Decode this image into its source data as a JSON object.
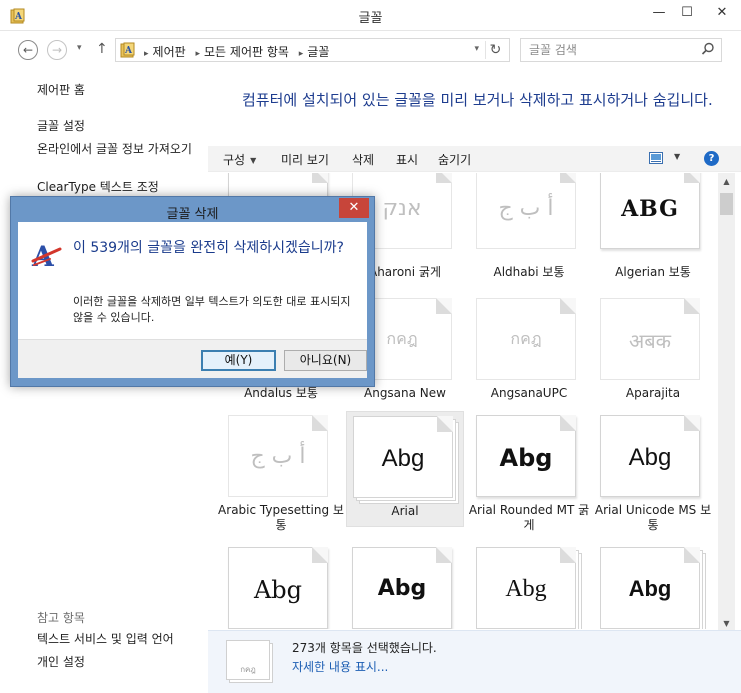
{
  "window": {
    "title": "글꼴",
    "min_glyph": "—",
    "max_glyph": "☐",
    "close_glyph": "✕"
  },
  "nav": {
    "back_glyph": "←",
    "forward_glyph": "→",
    "up_glyph": "↑",
    "recent_glyph": "▾"
  },
  "address": {
    "crumbs": [
      "제어판",
      "모든 제어판 항목",
      "글꼴"
    ],
    "separator": "▸",
    "refresh_glyph": "↻"
  },
  "search": {
    "placeholder": "글꼴 검색"
  },
  "sidebar": {
    "links": [
      {
        "label": "제어판 홈"
      },
      {
        "label": "글꼴 설정"
      },
      {
        "label": "온라인에서 글꼴 정보 가져오기"
      },
      {
        "label": "ClearType 텍스트 조정"
      },
      {
        "label": "텍스트 서비스 및 입력 언어"
      },
      {
        "label": "개인 설정"
      }
    ],
    "see_also": "참고 항목"
  },
  "main": {
    "headline": "컴퓨터에 설치되어 있는 글꼴을 미리 보거나 삭제하고 표시하거나 숨깁니다."
  },
  "toolbar": {
    "organize": "구성",
    "preview": "미리 보기",
    "delete": "삭제",
    "show": "표시",
    "hide": "숨기기",
    "help": "?"
  },
  "fonts": [
    {
      "name": "",
      "sample": "",
      "stack": false,
      "hidden": false
    },
    {
      "name": "Aharoni 굵게",
      "sample": "אנק",
      "stack": false,
      "hidden": true
    },
    {
      "name": "Aldhabi 보통",
      "sample": "أ ب ج",
      "stack": false,
      "hidden": true
    },
    {
      "name": "Algerian 보통",
      "sample": "ABG",
      "stack": false,
      "hidden": false
    },
    {
      "name": "Andalus 보통",
      "sample": "",
      "stack": false,
      "hidden": true
    },
    {
      "name": "Angsana New",
      "sample": "กคฎ",
      "stack": true,
      "hidden": true
    },
    {
      "name": "AngsanaUPC",
      "sample": "กคฎ",
      "stack": true,
      "hidden": true
    },
    {
      "name": "Aparajita",
      "sample": "अबक",
      "stack": true,
      "hidden": true
    },
    {
      "name": "Arabic Typesetting 보통",
      "sample": "أ ب ج",
      "stack": false,
      "hidden": true
    },
    {
      "name": "Arial",
      "sample": "Abg",
      "stack": true,
      "hidden": false
    },
    {
      "name": "Arial Rounded MT 굵게",
      "sample": "Abg",
      "stack": false,
      "hidden": false
    },
    {
      "name": "Arial Unicode MS 보통",
      "sample": "Abg",
      "stack": false,
      "hidden": false
    },
    {
      "name": "",
      "sample": "Abg",
      "stack": false,
      "hidden": false
    },
    {
      "name": "",
      "sample": "Abg",
      "stack": false,
      "hidden": false
    },
    {
      "name": "",
      "sample": "Abg",
      "stack": true,
      "hidden": false
    },
    {
      "name": "",
      "sample": "Abg",
      "stack": true,
      "hidden": false
    }
  ],
  "details": {
    "count": "273개 항목을 선택했습니다.",
    "more": "자세한 내용 표시...",
    "thumb_sample": "กคฎ"
  },
  "dialog": {
    "title": "글꼴 삭제",
    "close_glyph": "✕",
    "question": "이 539개의 글꼴을 완전히 삭제하시겠습니까?",
    "note": "이러한 글꼴을 삭제하면 일부 텍스트가 의도한 대로 표시되지 않을 수 있습니다.",
    "yes": "예(Y)",
    "no": "아니요(N)"
  },
  "scroll": {
    "up_glyph": "▲",
    "down_glyph": "▼"
  },
  "colors": {
    "accent_text": "#1e3d8f",
    "dialog_frame": "#6c97c8",
    "close_red": "#c7453a"
  }
}
